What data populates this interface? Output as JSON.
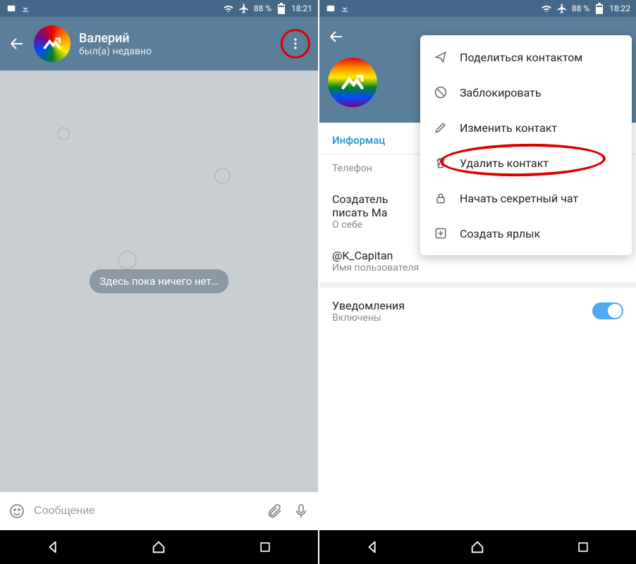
{
  "status": {
    "battery": "88 %",
    "time_left": "18:21",
    "time_right": "18:22"
  },
  "left": {
    "name": "Валерий",
    "last_seen": "был(а) недавно",
    "empty": "Здесь пока ничего нет…",
    "placeholder": "Сообщение"
  },
  "right": {
    "info_tab": "Информац",
    "phone_label": "Телефон",
    "about_text": "Создатель\nписать Ма",
    "about_label": "О себе",
    "username": "@K_Capitan",
    "username_label": "Имя пользователя",
    "notif_title": "Уведомления",
    "notif_status": "Включены"
  },
  "menu": {
    "share": "Поделиться контактом",
    "block": "Заблокировать",
    "edit": "Изменить контакт",
    "delete": "Удалить контакт",
    "secret": "Начать секретный чат",
    "shortcut": "Создать ярлык"
  }
}
